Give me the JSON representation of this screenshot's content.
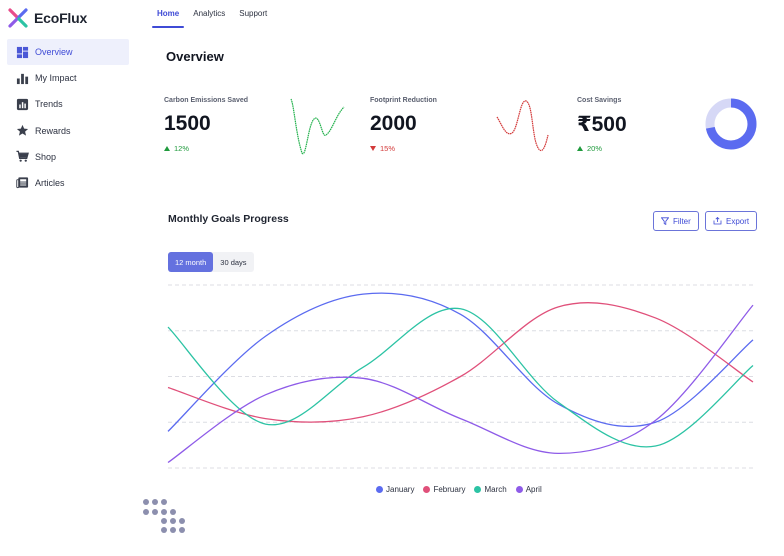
{
  "app": {
    "name": "EcoFlux",
    "logo_colors": [
      "#e84d8a",
      "#5b6bf0",
      "#2cc3a4",
      "#8e5be8"
    ]
  },
  "sidebar": {
    "items": [
      {
        "label": "Overview",
        "icon": "dashboard-icon",
        "active": true
      },
      {
        "label": "My Impact",
        "icon": "bar-chart-icon",
        "active": false
      },
      {
        "label": "Trends",
        "icon": "trend-chart-icon",
        "active": false
      },
      {
        "label": "Rewards",
        "icon": "star-icon",
        "active": false
      },
      {
        "label": "Shop",
        "icon": "cart-icon",
        "active": false
      },
      {
        "label": "Articles",
        "icon": "newspaper-icon",
        "active": false
      }
    ]
  },
  "tabs": [
    {
      "label": "Home",
      "active": true
    },
    {
      "label": "Analytics",
      "active": false
    },
    {
      "label": "Support",
      "active": false
    }
  ],
  "page": {
    "title": "Overview"
  },
  "stats": [
    {
      "label": "Carbon Emissions Saved",
      "value": "1500",
      "delta": "12%",
      "trend": "up",
      "color": "#22b14c"
    },
    {
      "label": "Footprint Reduction",
      "value": "2000",
      "delta": "15%",
      "trend": "down",
      "color": "#d33a3a"
    },
    {
      "label": "Cost Savings",
      "value": "₹500",
      "delta": "20%",
      "trend": "up",
      "color": "#5b6bf0",
      "donut_fraction": 0.72
    }
  ],
  "goals": {
    "title": "Monthly Goals Progress",
    "filter_label": "Filter",
    "export_label": "Export",
    "ranges": [
      {
        "label": "12 month",
        "active": true
      },
      {
        "label": "30 days",
        "active": false
      }
    ]
  },
  "colors": {
    "accent": "#5b6bf0",
    "up": "#1f9a3c",
    "down": "#d33a3a",
    "grid": "#dcdde3"
  },
  "chart_data": {
    "type": "line",
    "x": [
      0,
      1,
      2,
      3,
      4,
      5,
      6
    ],
    "ylim": [
      0,
      100
    ],
    "grid": true,
    "legend": "bottom",
    "series": [
      {
        "name": "January",
        "color": "#5b6bf0",
        "values": [
          20,
          72,
          95,
          84,
          35,
          25,
          70
        ]
      },
      {
        "name": "February",
        "color": "#e0507a",
        "values": [
          44,
          27,
          28,
          50,
          88,
          82,
          47
        ]
      },
      {
        "name": "March",
        "color": "#2cc3a4",
        "values": [
          77,
          24,
          55,
          87,
          36,
          12,
          56
        ]
      },
      {
        "name": "April",
        "color": "#8e5be8",
        "values": [
          3,
          40,
          49,
          27,
          8,
          26,
          89
        ]
      }
    ]
  }
}
